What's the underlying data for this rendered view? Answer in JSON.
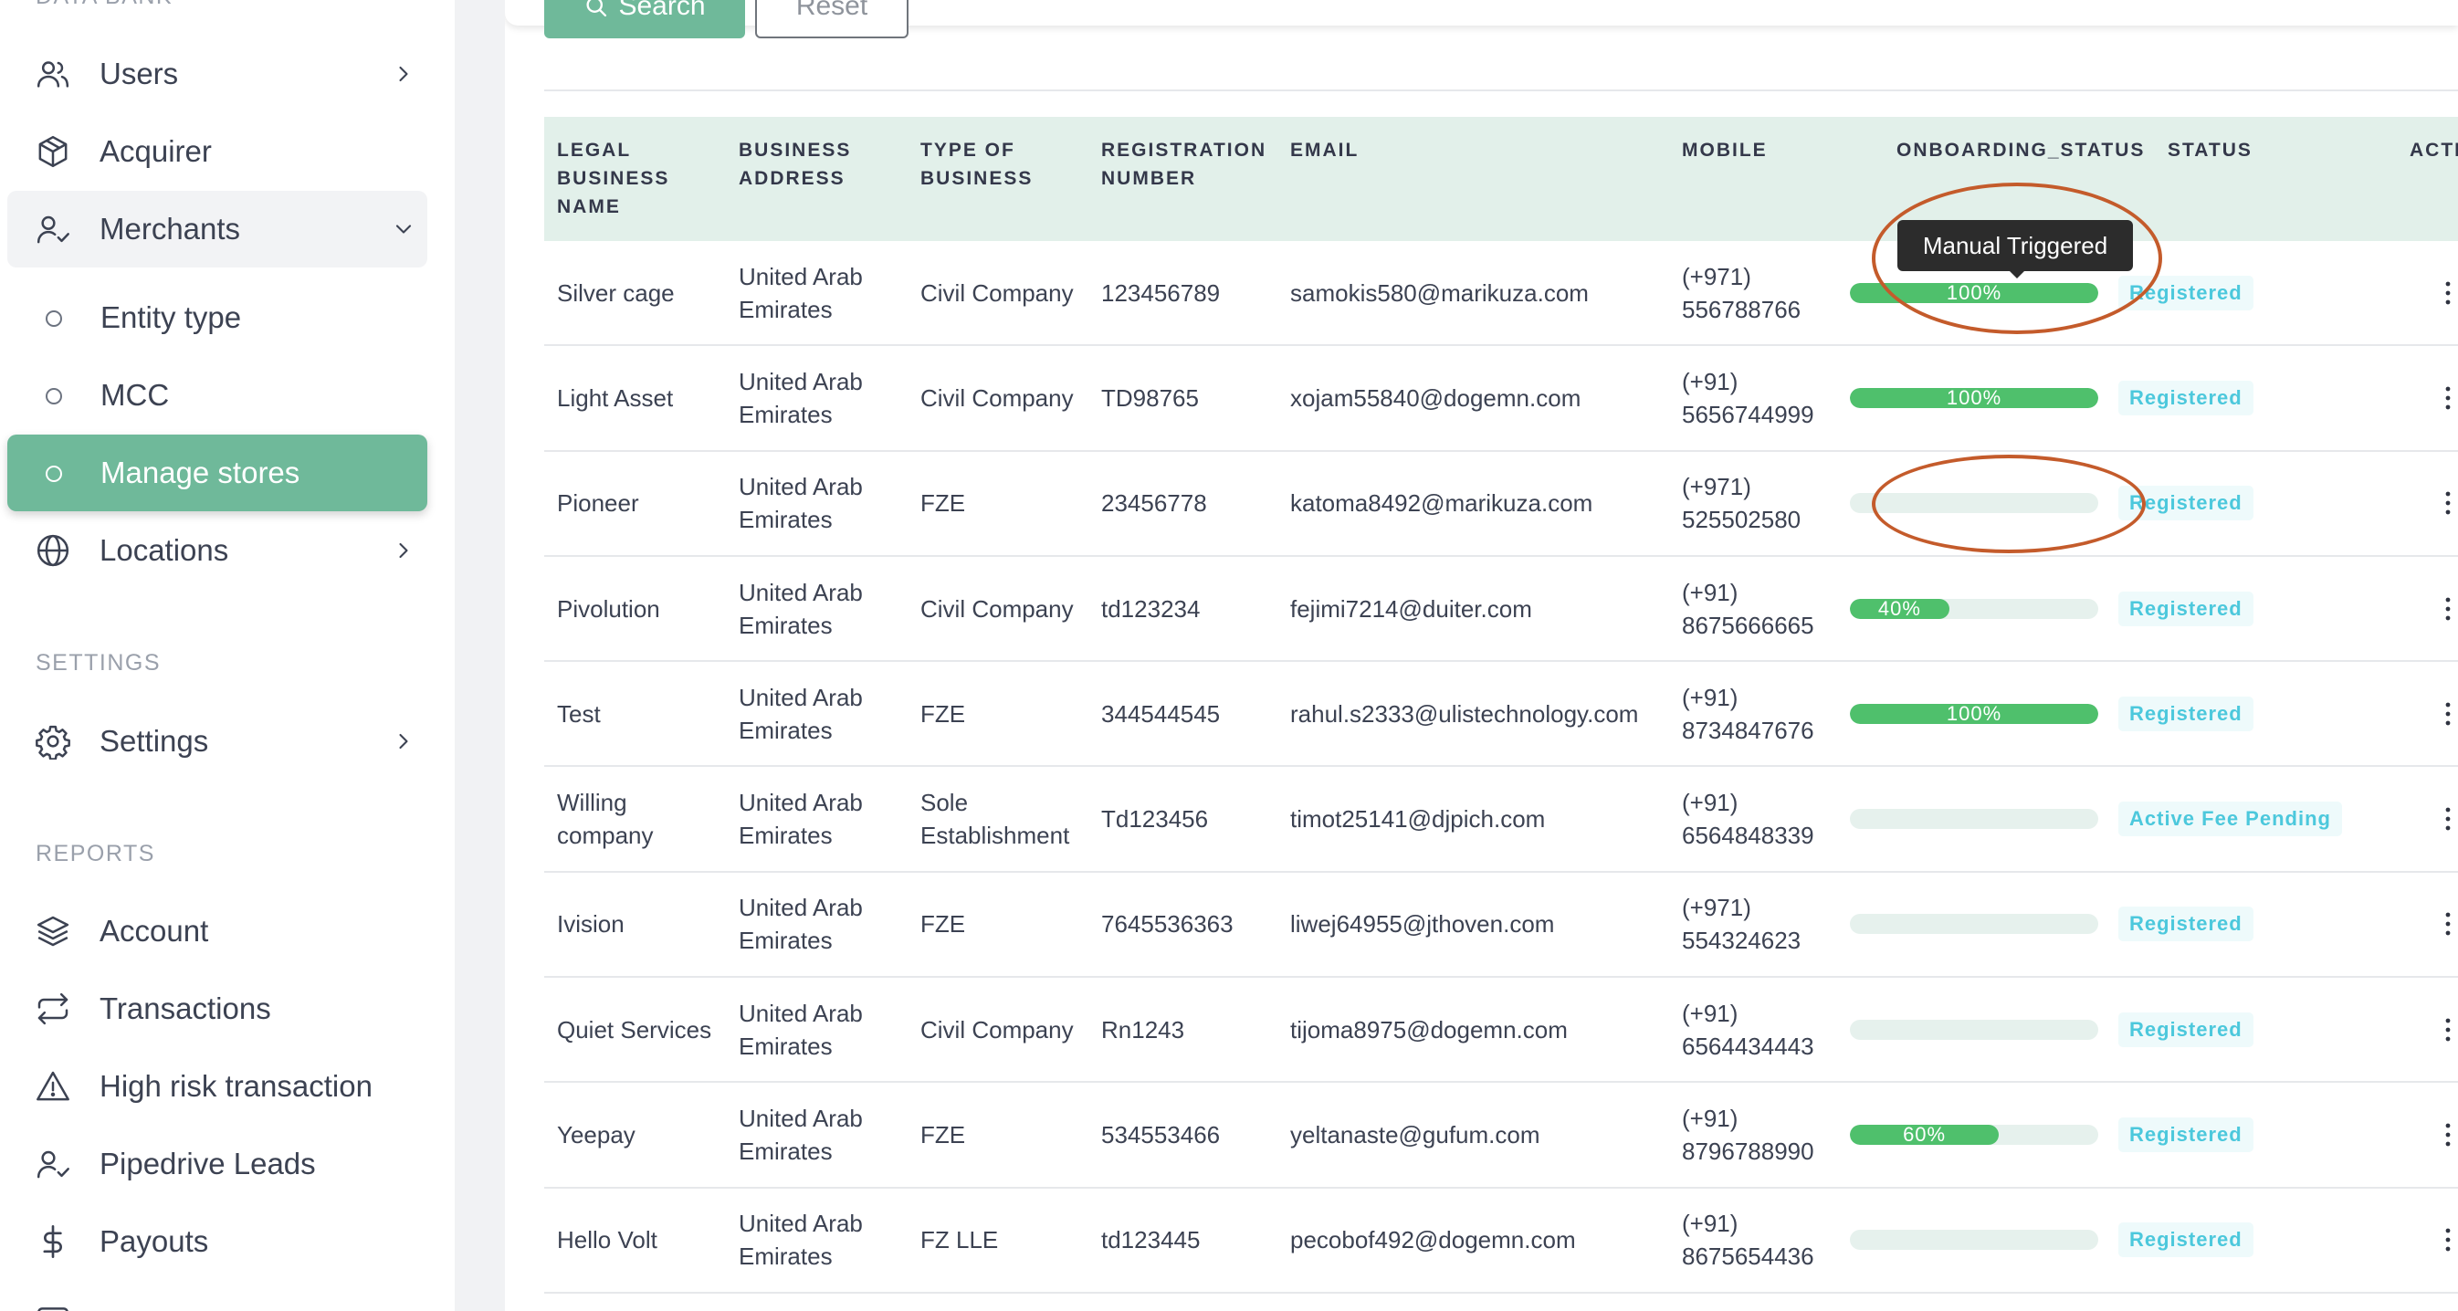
{
  "sidebar": {
    "section_data_bank": "DATA BANK",
    "section_settings": "SETTINGS",
    "section_reports": "REPORTS",
    "items": {
      "users": "Users",
      "acquirer": "Acquirer",
      "merchants": "Merchants",
      "entity_type": "Entity type",
      "mcc": "MCC",
      "manage_stores": "Manage stores",
      "locations": "Locations",
      "settings": "Settings",
      "account": "Account",
      "transactions": "Transactions",
      "high_risk": "High risk transaction",
      "pipedrive": "Pipedrive Leads",
      "payouts": "Payouts"
    },
    "active_item": "Manage stores",
    "expanded_item": "Merchants"
  },
  "filters": {
    "search_label": "Search",
    "reset_label": "Reset"
  },
  "table": {
    "headers": {
      "legal_name": "LEGAL BUSINESS NAME",
      "address": "BUSINESS ADDRESS",
      "type": "TYPE OF BUSINESS",
      "registration": "REGISTRATION NUMBER",
      "email": "EMAIL",
      "mobile": "MOBILE",
      "onboarding": "ONBOARDING_STATUS",
      "status": "STATUS",
      "actions": "ACTI"
    },
    "rows": [
      {
        "name": "Silver cage",
        "address": "United Arab Emirates",
        "type": "Civil Company",
        "registration": "123456789",
        "email": "samokis580@marikuza.com",
        "mobile": "(+971) 556788766",
        "progress": 100,
        "progress_label": "100%",
        "status": "Registered"
      },
      {
        "name": "Light Asset",
        "address": "United Arab Emirates",
        "type": "Civil Company",
        "registration": "TD98765",
        "email": "xojam55840@dogemn.com",
        "mobile": "(+91) 5656744999",
        "progress": 100,
        "progress_label": "100%",
        "status": "Registered"
      },
      {
        "name": "Pioneer",
        "address": "United Arab Emirates",
        "type": "FZE",
        "registration": "23456778",
        "email": "katoma8492@marikuza.com",
        "mobile": "(+971) 525502580",
        "progress": 0,
        "progress_label": "",
        "status": "Registered"
      },
      {
        "name": "Pivolution",
        "address": "United Arab Emirates",
        "type": "Civil Company",
        "registration": "td123234",
        "email": "fejimi7214@duiter.com",
        "mobile": "(+91) 8675666665",
        "progress": 40,
        "progress_label": "40%",
        "status": "Registered"
      },
      {
        "name": "Test",
        "address": "United Arab Emirates",
        "type": "FZE",
        "registration": "344544545",
        "email": "rahul.s2333@ulistechnology.com",
        "mobile": "(+91) 8734847676",
        "progress": 100,
        "progress_label": "100%",
        "status": "Registered"
      },
      {
        "name": "Willing company",
        "address": "United Arab Emirates",
        "type": "Sole Establishment",
        "registration": "Td123456",
        "email": "timot25141@djpich.com",
        "mobile": "(+91) 6564848339",
        "progress": 0,
        "progress_label": "",
        "status": "Active Fee Pending"
      },
      {
        "name": "Ivision",
        "address": "United Arab Emirates",
        "type": "FZE",
        "registration": "7645536363",
        "email": "liwej64955@jthoven.com",
        "mobile": "(+971) 554324623",
        "progress": 0,
        "progress_label": "",
        "status": "Registered"
      },
      {
        "name": "Quiet Services",
        "address": "United Arab Emirates",
        "type": "Civil Company",
        "registration": "Rn1243",
        "email": "tijoma8975@dogemn.com",
        "mobile": "(+91) 6564434443",
        "progress": 0,
        "progress_label": "",
        "status": "Registered"
      },
      {
        "name": "Yeepay",
        "address": "United Arab Emirates",
        "type": "FZE",
        "registration": "534553466",
        "email": "yeltanaste@gufum.com",
        "mobile": "(+91) 8796788990",
        "progress": 60,
        "progress_label": "60%",
        "status": "Registered"
      },
      {
        "name": "Hello Volt",
        "address": "United Arab Emirates",
        "type": "FZ LLE",
        "registration": "td123445",
        "email": "pecobof492@dogemn.com",
        "mobile": "(+91) 8675654436",
        "progress": 0,
        "progress_label": "",
        "status": "Registered"
      }
    ]
  },
  "tooltip": {
    "text": "Manual Triggered"
  },
  "colors": {
    "accent": "#6fb99a",
    "progress_fill": "#4fc06c",
    "status_text": "#4cc8dc",
    "annotation": "#c45b2b",
    "header_bg": "#e2f0ea"
  }
}
